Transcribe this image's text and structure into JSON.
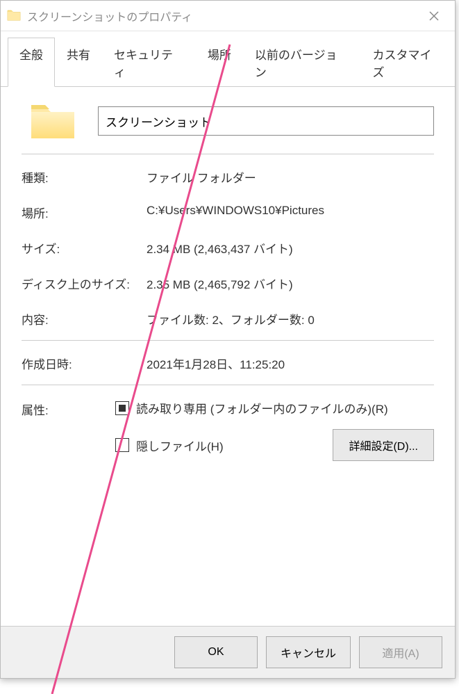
{
  "titlebar": {
    "title": "スクリーンショットのプロパティ"
  },
  "tabs": {
    "general": "全般",
    "sharing": "共有",
    "security": "セキュリティ",
    "location": "場所",
    "previous": "以前のバージョン",
    "customize": "カスタマイズ"
  },
  "name_field": {
    "value": "スクリーンショット"
  },
  "info": {
    "type_label": "種類:",
    "type_value": "ファイル フォルダー",
    "location_label": "場所:",
    "location_value": "C:¥Users¥WINDOWS10¥Pictures",
    "size_label": "サイズ:",
    "size_value": "2.34 MB (2,463,437 バイト)",
    "disk_size_label": "ディスク上のサイズ:",
    "disk_size_value": "2.35 MB (2,465,792 バイト)",
    "contents_label": "内容:",
    "contents_value": "ファイル数: 2、フォルダー数: 0",
    "created_label": "作成日時:",
    "created_value": "2021年1月28日、11:25:20"
  },
  "attributes": {
    "label": "属性:",
    "readonly_label": "読み取り専用 (フォルダー内のファイルのみ)(R)",
    "hidden_label": "隠しファイル(H)",
    "advanced_button": "詳細設定(D)..."
  },
  "buttons": {
    "ok": "OK",
    "cancel": "キャンセル",
    "apply": "適用(A)"
  }
}
